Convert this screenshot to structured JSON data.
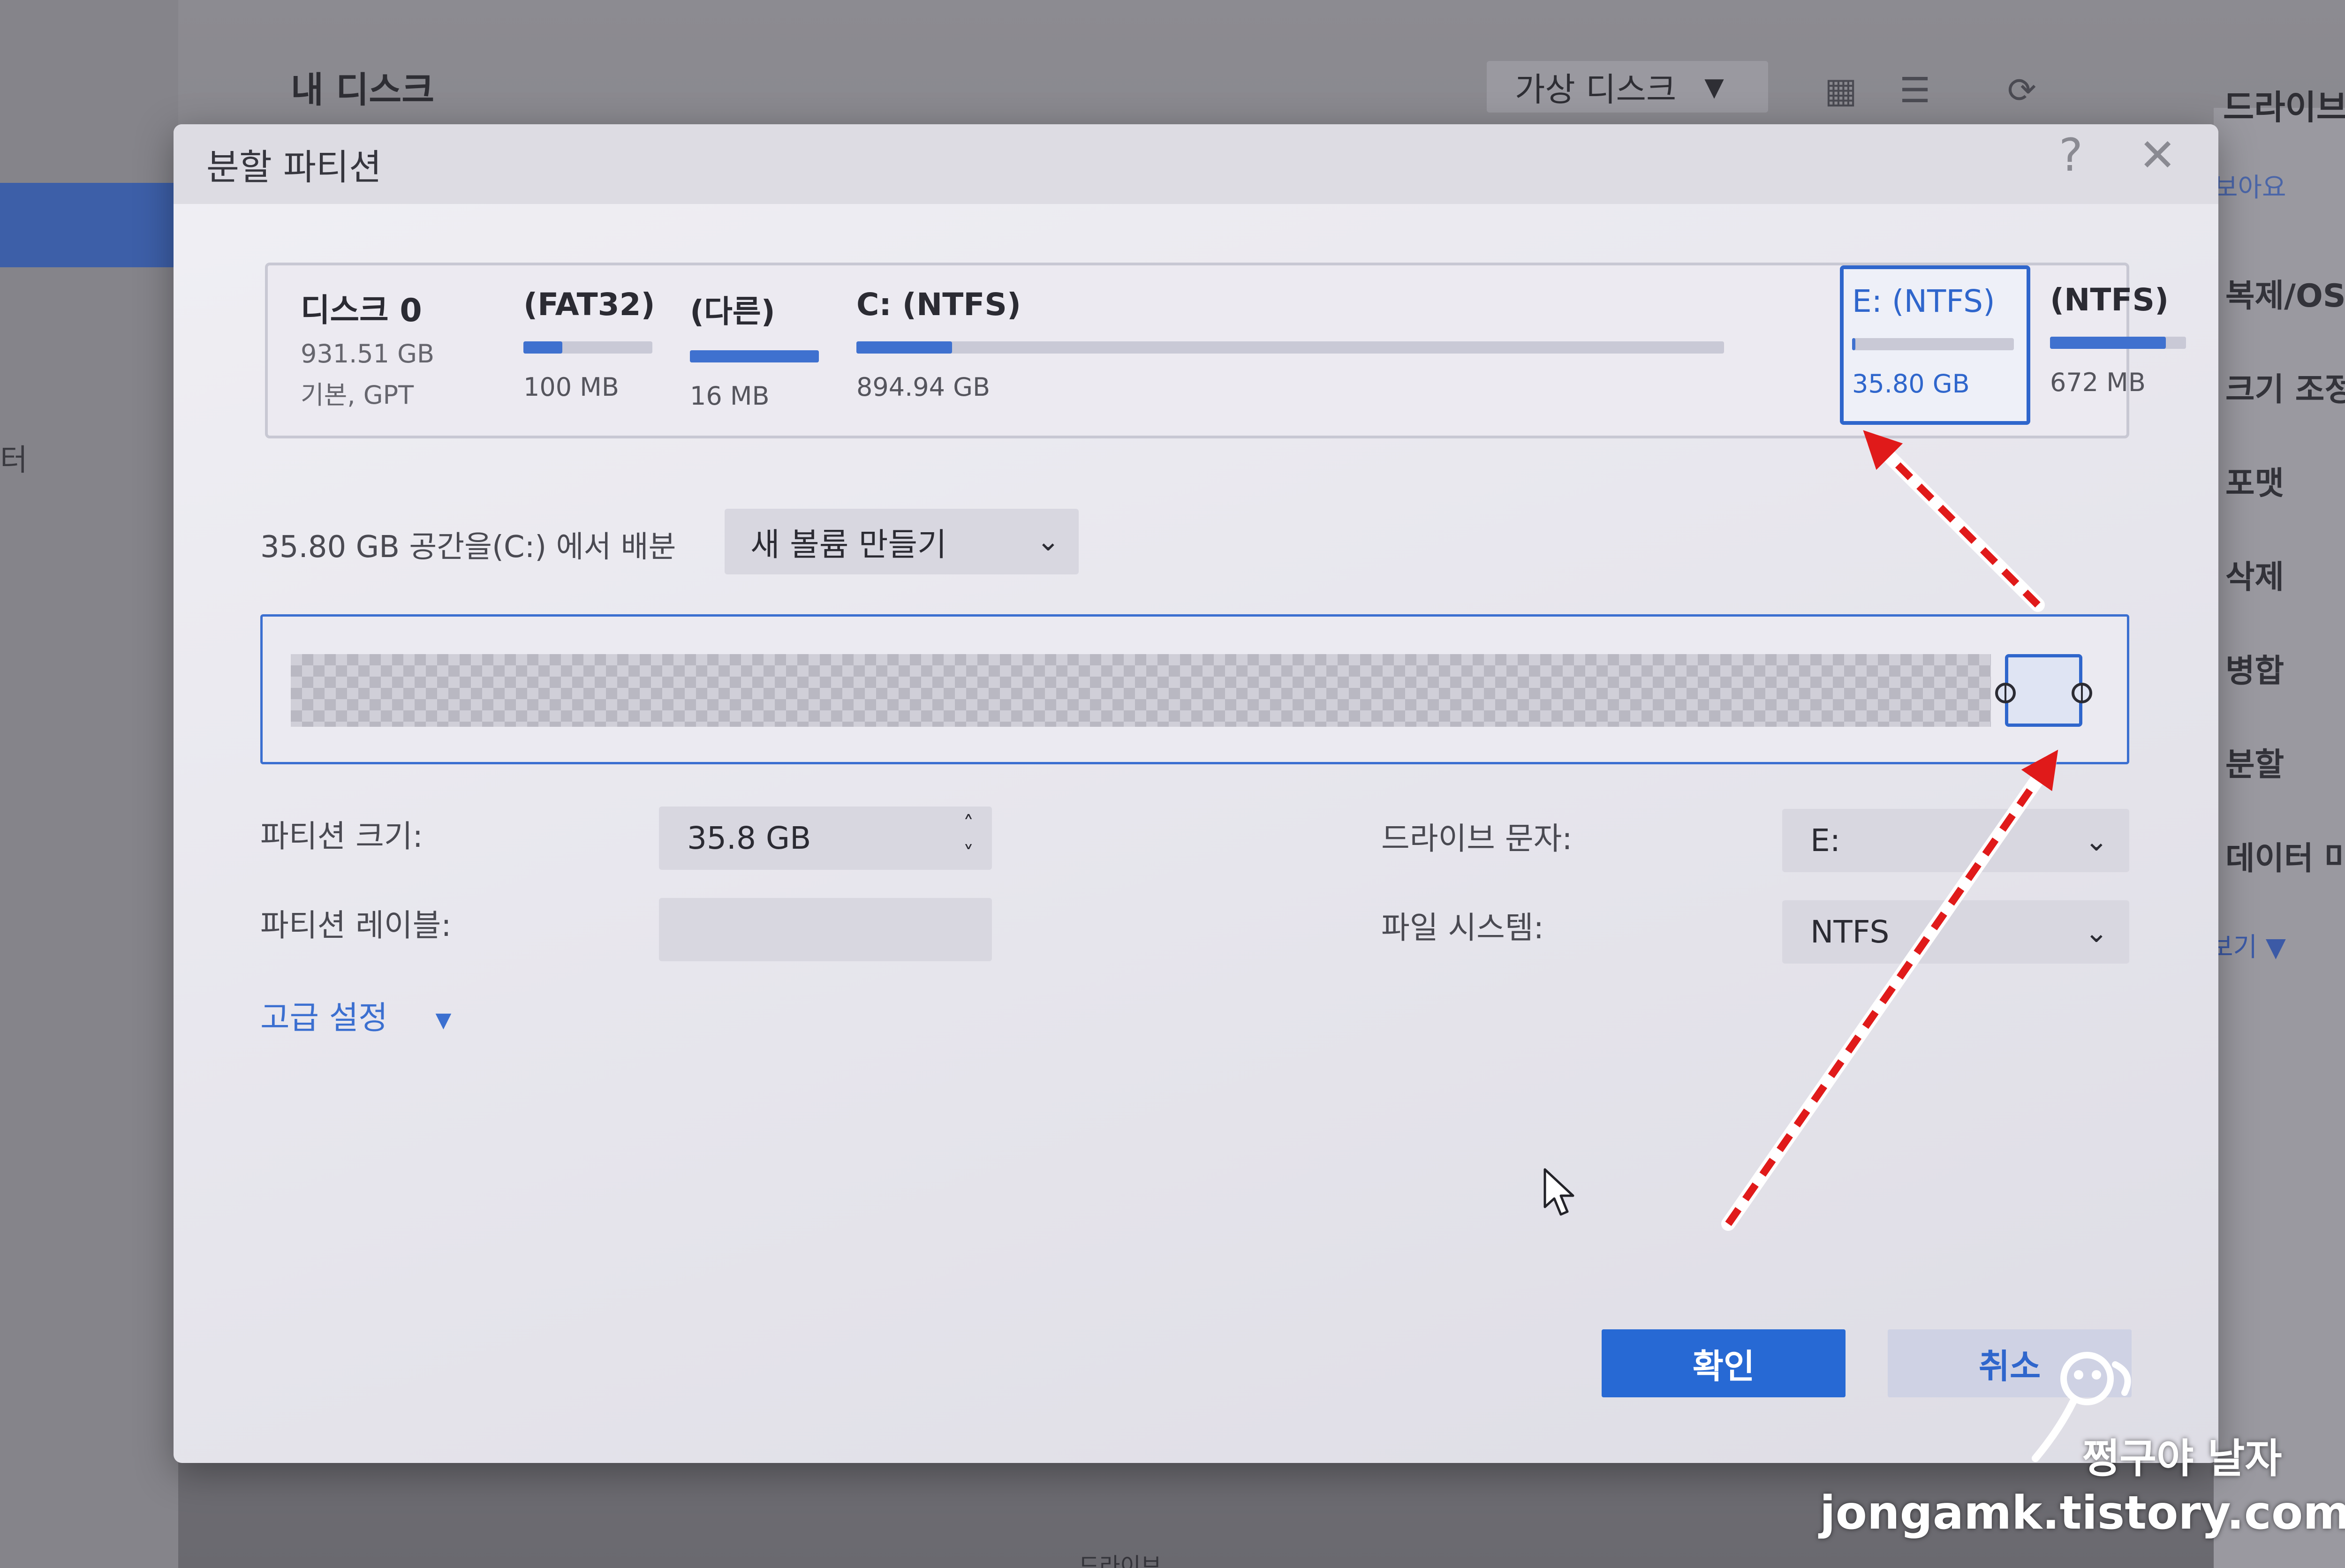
{
  "background": {
    "title": "내 디스크",
    "toolbar_select": "가상 디스크",
    "left_text": "터",
    "right_panel": {
      "head": "드라이브",
      "sub": "보아요",
      "items": [
        "복제/OS",
        "크기 조정",
        "포맷",
        "삭제",
        "병합",
        "분할",
        "데이터 마"
      ],
      "more": "보기"
    },
    "bottom_text": "드라이브"
  },
  "dialog": {
    "title": "분할 파티션",
    "help_symbol": "?",
    "close_symbol": "✕",
    "disk": {
      "name": "디스크 0",
      "size": "931.51 GB",
      "type": "기본, GPT"
    },
    "partitions": [
      {
        "name": "(FAT32)",
        "size": "100 MB",
        "used_fraction": 0.3
      },
      {
        "name": "(다른)",
        "size": "16 MB",
        "used_fraction": 1.0
      },
      {
        "name": "C: (NTFS)",
        "size": "894.94 GB",
        "used_fraction": 0.11
      },
      {
        "name": "E: (NTFS)",
        "size": "35.80 GB",
        "used_fraction": 0.02,
        "selected": true
      },
      {
        "name": "(NTFS)",
        "size": "672 MB",
        "used_fraction": 0.85
      }
    ],
    "allocation": {
      "text": "35.80 GB 공간을(C:) 에서 배분",
      "select_value": "새 볼륨 만들기"
    },
    "fields": {
      "size_label": "파티션 크기:",
      "size_value": "35.8 GB",
      "label_label": "파티션 레이블:",
      "label_value": "",
      "drive_letter_label": "드라이브 문자:",
      "drive_letter_value": "E:",
      "fs_label": "파일 시스템:",
      "fs_value": "NTFS"
    },
    "advanced_label": "고급 설정",
    "ok_label": "확인",
    "cancel_label": "취소"
  },
  "watermark": {
    "line1": "쩡구야 날자",
    "line2": "jongamk.tistory.com"
  },
  "colors": {
    "accent": "#2f66cc",
    "ok_button": "#2769d4",
    "arrow": "#e01a1a"
  }
}
